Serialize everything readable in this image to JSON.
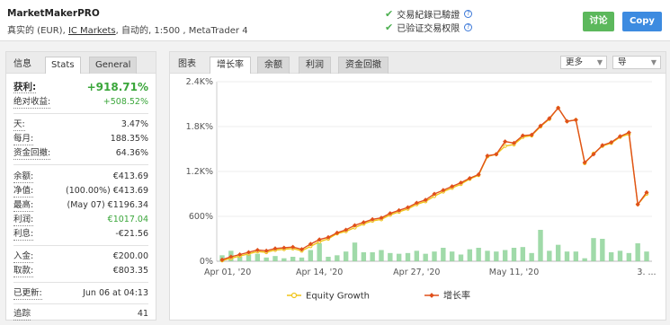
{
  "header": {
    "title": "MarketMakerPRO",
    "subtitle_pre": "真实的 (EUR), ",
    "broker_link": "IC Markets",
    "subtitle_post": ", 自动的, 1:500 , MetaTrader 4",
    "checks": [
      "交易紀錄已驗證",
      "已验证交易权限"
    ],
    "discuss_label": "讨论",
    "copy_label": "Copy"
  },
  "left_tabs": [
    "信息",
    "Stats",
    "General"
  ],
  "stats": {
    "gain": {
      "label": "获利:",
      "value": "+918.71%"
    },
    "abs_gain": {
      "label": "绝对收益:",
      "value": "+508.52%"
    },
    "daily": {
      "label": "天:",
      "value": "3.47%"
    },
    "monthly": {
      "label": "每月:",
      "value": "188.35%"
    },
    "drawdown": {
      "label": "资金回撤:",
      "value": "64.36%"
    },
    "balance": {
      "label": "余额:",
      "value": "€413.69"
    },
    "equity": {
      "label": "净值:",
      "value": "(100.00%) €413.69"
    },
    "highest": {
      "label": "最高:",
      "value": "(May 07) €1196.34"
    },
    "profit": {
      "label": "利润:",
      "value": "€1017.04"
    },
    "interest": {
      "label": "利息:",
      "value": "-€21.56"
    },
    "deposits": {
      "label": "入金:",
      "value": "€200.00"
    },
    "withdrawals": {
      "label": "取款:",
      "value": "€803.35"
    },
    "updated": {
      "label": "已更新:",
      "value": "Jun 06 at 04:13"
    },
    "tracking": {
      "label": "追踪",
      "value": "41"
    }
  },
  "right_tabs": [
    "图表",
    "增长率",
    "余额",
    "利润",
    "资金回撤"
  ],
  "dropdowns": [
    "更多",
    "导"
  ],
  "colors": {
    "equity": "#f0c419",
    "growth": "#e0501b",
    "bars": "#8fd49a",
    "green": "#3aa63a",
    "discuss": "#5cb85c",
    "copy": "#3d8be0"
  },
  "chart_data": {
    "type": "line",
    "y_ticks": [
      "2.4K%",
      "1.8K%",
      "1.2K%",
      "600%",
      "0%"
    ],
    "ylim": [
      0,
      2400
    ],
    "x_ticks": [
      "Apr 01, '20",
      "Apr 14, '20",
      "Apr 27, '20",
      "May 11, '20",
      "3. ..."
    ],
    "series": [
      {
        "name": "Equity Growth",
        "values": [
          10,
          40,
          70,
          100,
          130,
          120,
          150,
          160,
          170,
          140,
          200,
          260,
          300,
          370,
          400,
          450,
          500,
          540,
          560,
          620,
          660,
          700,
          760,
          800,
          870,
          930,
          980,
          1030,
          1100,
          1150,
          1400,
          1430,
          1540,
          1560,
          1660,
          1680,
          1800,
          1900,
          2050,
          1870,
          1890,
          1310,
          1440,
          1540,
          1580,
          1660,
          1700,
          760,
          900
        ]
      },
      {
        "name": "增长率",
        "values": [
          20,
          60,
          90,
          120,
          150,
          140,
          170,
          180,
          190,
          160,
          230,
          290,
          320,
          380,
          420,
          480,
          520,
          560,
          580,
          640,
          680,
          720,
          780,
          820,
          900,
          950,
          1000,
          1050,
          1110,
          1160,
          1410,
          1430,
          1600,
          1580,
          1680,
          1690,
          1810,
          1910,
          2050,
          1870,
          1890,
          1320,
          1430,
          1550,
          1590,
          1670,
          1720,
          760,
          920
        ]
      }
    ],
    "bars": [
      80,
      140,
      60,
      90,
      100,
      50,
      70,
      40,
      60,
      50,
      150,
      240,
      60,
      80,
      130,
      250,
      120,
      120,
      150,
      110,
      100,
      110,
      140,
      100,
      130,
      180,
      130,
      90,
      160,
      180,
      140,
      130,
      150,
      180,
      190,
      110,
      420,
      140,
      220,
      130,
      130,
      40,
      310,
      300,
      120,
      140,
      110,
      240,
      130
    ]
  }
}
